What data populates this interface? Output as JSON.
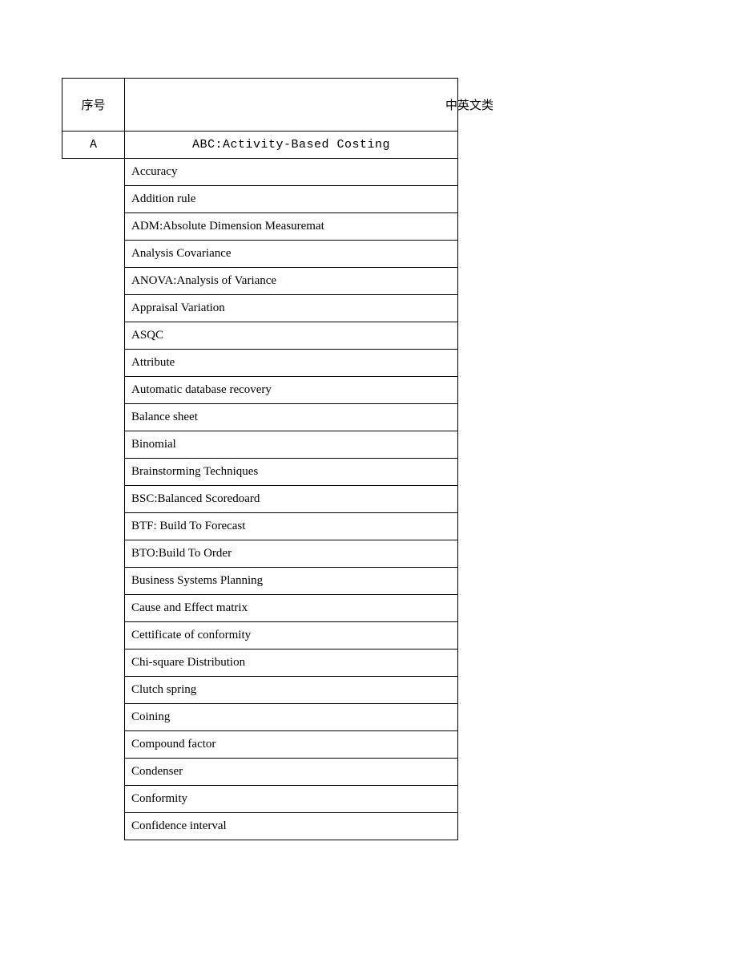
{
  "header": {
    "col1": "序号",
    "col2": "中英文类"
  },
  "sectionLabel": "A",
  "firstRow": "ABC:Activity-Based Costing",
  "rows": [
    "Accuracy",
    "Addition rule",
    "ADM:Absolute Dimension Measuremat",
    "Analysis Covariance",
    "ANOVA:Analysis of Variance",
    "Appraisal Variation",
    "ASQC",
    "Attribute",
    "Automatic database recovery",
    "Balance sheet",
    "Binomial",
    "Brainstorming Techniques",
    "BSC:Balanced Scoredoard",
    "BTF: Build To Forecast",
    "BTO:Build To Order",
    "Business Systems Planning",
    "Cause and Effect matrix",
    "Cettificate of conformity",
    "Chi-square Distribution",
    "Clutch spring",
    "Coining",
    "Compound factor",
    "Condenser",
    "Conformity",
    "Confidence interval"
  ]
}
